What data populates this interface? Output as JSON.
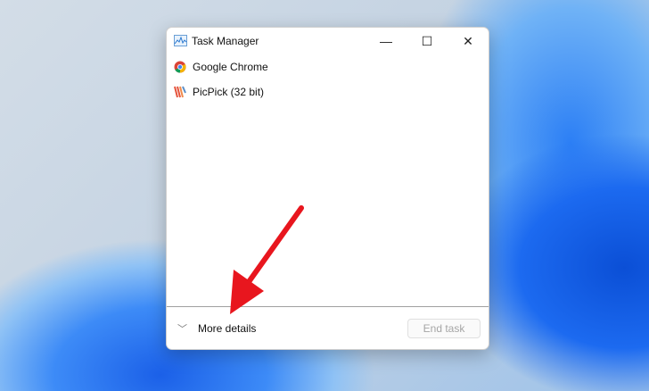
{
  "window": {
    "title": "Task Manager",
    "minimize": "—",
    "maximize": "☐",
    "close": "✕"
  },
  "apps": [
    {
      "name": "Google Chrome",
      "icon": "chrome-icon"
    },
    {
      "name": "PicPick (32 bit)",
      "icon": "picpick-icon"
    }
  ],
  "footer": {
    "more_details": "More details",
    "chevron": "﹀",
    "end_task": "End task"
  },
  "colors": {
    "annotation_arrow": "#e8161e"
  }
}
